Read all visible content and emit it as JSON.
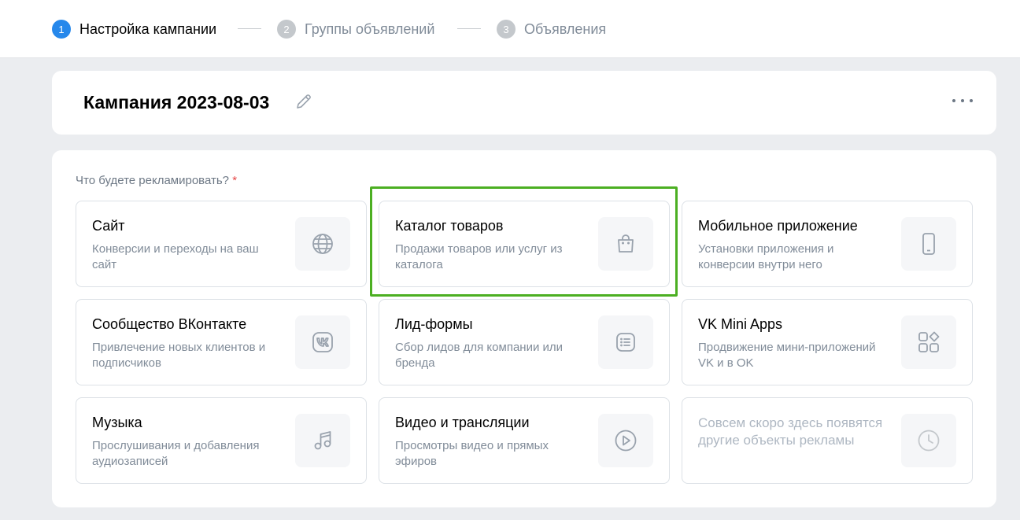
{
  "steps": [
    {
      "num": "1",
      "label": "Настройка кампании",
      "state": "active"
    },
    {
      "num": "2",
      "label": "Группы объявлений",
      "state": "inactive"
    },
    {
      "num": "3",
      "label": "Объявления",
      "state": "inactive"
    }
  ],
  "campaign": {
    "title": "Кампания 2023-08-03",
    "edit_icon": "pencil-icon",
    "more_icon": "more-horizontal-icon"
  },
  "form": {
    "question": "Что будете рекламировать?",
    "required_mark": "*"
  },
  "options": [
    {
      "title": "Сайт",
      "desc": "Конверсии и переходы на ваш сайт",
      "icon": "globe-icon"
    },
    {
      "title": "Каталог товаров",
      "desc": "Продажи товаров или услуг из каталога",
      "icon": "shopping-bag-icon",
      "highlighted": true
    },
    {
      "title": "Мобильное приложение",
      "desc": "Установки приложения и конверсии внутри него",
      "icon": "smartphone-icon"
    },
    {
      "title": "Сообщество ВКонтакте",
      "desc": "Привлечение новых клиентов и подписчиков",
      "icon": "vk-logo-icon"
    },
    {
      "title": "Лид-формы",
      "desc": "Сбор лидов для компании или бренда",
      "icon": "list-form-icon"
    },
    {
      "title": "VK Mini Apps",
      "desc": "Продвижение мини-приложений VK и в OK",
      "icon": "apps-grid-icon"
    },
    {
      "title": "Музыка",
      "desc": "Прослушивания и добавления аудиозаписей",
      "icon": "music-note-icon"
    },
    {
      "title": "Видео и трансляции",
      "desc": "Просмотры видео и прямых эфиров",
      "icon": "play-circle-icon"
    },
    {
      "title": "",
      "desc": "Совсем скоро здесь появятся другие объекты рекламы",
      "icon": "clock-icon",
      "disabled": true
    }
  ],
  "colors": {
    "accent": "#2688eb",
    "highlight": "#4caf22",
    "muted": "#818c99",
    "icon": "#99a2ad",
    "required": "#e64646"
  }
}
